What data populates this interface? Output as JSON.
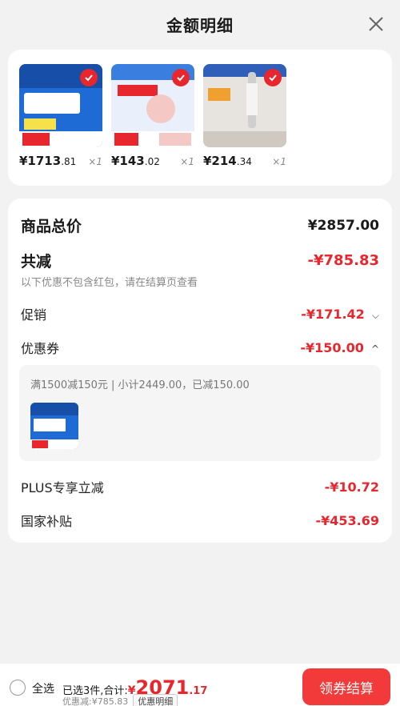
{
  "header": {
    "title": "金额明细"
  },
  "products": [
    {
      "price_int": "¥1713",
      "price_dec": ".81",
      "qty": "×1",
      "color": "#1f6bd6",
      "sub": "#e8262d"
    },
    {
      "price_int": "¥143",
      "price_dec": ".02",
      "qty": "×1",
      "color": "#3a7fe0",
      "sub": "#f4c8c4"
    },
    {
      "price_int": "¥214",
      "price_dec": ".34",
      "qty": "×1",
      "color": "#e7e3df",
      "sub": "#f0a030"
    }
  ],
  "summary": {
    "total_label": "商品总价",
    "total_value": "¥2857.00",
    "discount_label": "共减",
    "discount_value": "-¥785.83",
    "note": "以下优惠不包含红包，请在结算页查看",
    "promo_label": "促销",
    "promo_value": "-¥171.42",
    "coupon_label": "优惠券",
    "coupon_value": "-¥150.00",
    "coupon_detail": "满1500减150元 | 小计2449.00，已减150.00",
    "plus_label": "PLUS专享立减",
    "plus_value": "-¥10.72",
    "subsidy_label": "国家补贴",
    "subsidy_value": "-¥453.69"
  },
  "footer": {
    "select_all": "全选",
    "selected_text": "已选3件,合计:",
    "total_symbol": "¥",
    "total_int": "2071",
    "total_dec": ".17",
    "discount_text": "优惠减:¥785.83",
    "detail_button": "优惠明细",
    "checkout_button": "领券结算"
  }
}
